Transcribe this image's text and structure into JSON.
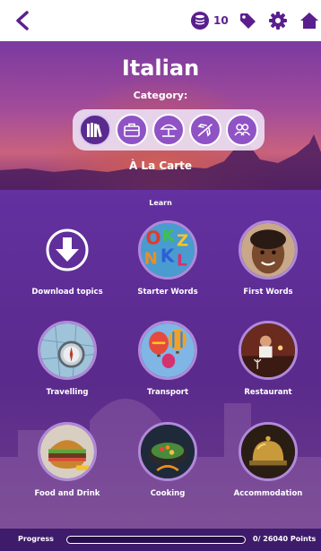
{
  "topbar": {
    "coins": "10",
    "icons": [
      "back-arrow-icon",
      "coin-stack-icon",
      "tag-icon",
      "gear-icon",
      "home-icon"
    ]
  },
  "header": {
    "title": "Italian",
    "category_label": "Category:",
    "current_category": "À La Carte",
    "categories": [
      {
        "icon": "books-icon",
        "active": true
      },
      {
        "icon": "briefcase-icon",
        "active": false
      },
      {
        "icon": "beach-umbrella-icon",
        "active": false
      },
      {
        "icon": "airplane-icon",
        "active": false
      },
      {
        "icon": "people-icon",
        "active": false
      }
    ]
  },
  "learn": {
    "title": "Learn",
    "tiles": [
      {
        "label": "Download topics",
        "icon": "download-icon"
      },
      {
        "label": "Starter Words",
        "icon": "letters-photo"
      },
      {
        "label": "First Words",
        "icon": "child-photo"
      },
      {
        "label": "Travelling",
        "icon": "compass-map-photo"
      },
      {
        "label": "Transport",
        "icon": "balloons-photo"
      },
      {
        "label": "Restaurant",
        "icon": "restaurant-photo"
      },
      {
        "label": "Food and Drink",
        "icon": "burger-photo"
      },
      {
        "label": "Cooking",
        "icon": "wok-photo"
      },
      {
        "label": "Accommodation",
        "icon": "bell-photo"
      }
    ]
  },
  "progress": {
    "label": "Progress",
    "points_text": "0/ 26040 Points",
    "fraction": 0
  },
  "colors": {
    "brand_purple": "#5a1f8e",
    "accent": "#8f53c6"
  }
}
